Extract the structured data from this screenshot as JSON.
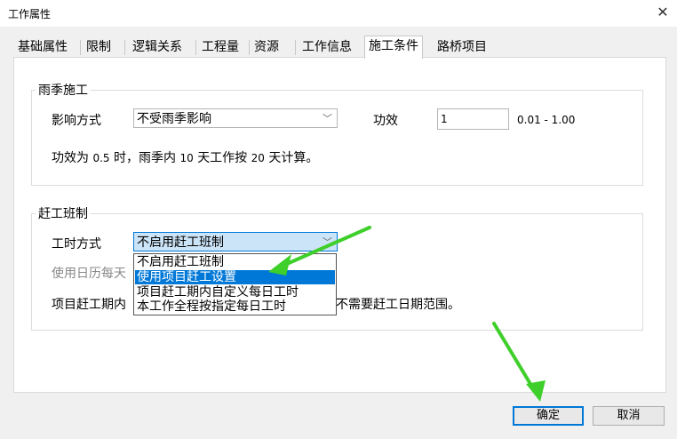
{
  "window": {
    "title": "工作属性",
    "close_icon": "close-icon"
  },
  "tabs": [
    {
      "label": "基础属性",
      "active": false
    },
    {
      "label": "限制",
      "active": false
    },
    {
      "label": "逻辑关系",
      "active": false
    },
    {
      "label": "工程量",
      "active": false
    },
    {
      "label": "资源",
      "active": false
    },
    {
      "label": "工作信息",
      "active": false
    },
    {
      "label": "施工条件",
      "active": true
    },
    {
      "label": "路桥项目",
      "active": false
    }
  ],
  "rain": {
    "group_label": "雨季施工",
    "impact_label": "影响方式",
    "impact_value": "不受雨季影响",
    "efficiency_label": "功效",
    "efficiency_value": "1",
    "efficiency_range": "0.01 - 1.00",
    "desc_1": "功效为",
    "desc_val1": "0.5",
    "desc_2": "时，雨季内",
    "desc_val2": "10",
    "desc_3": "天工作按",
    "desc_val3": "20",
    "desc_4": "天计算。"
  },
  "rush": {
    "group_label": "赶工班制",
    "mode_label": "工时方式",
    "mode_value": "不启用赶工班制",
    "calendar_hint": "使用日历每天",
    "period_text_left": "项目赶工期内",
    "period_text_right": "不需要赶工日期范围。",
    "options": [
      {
        "label": "不启用赶工班制",
        "selected": false
      },
      {
        "label": "使用项目赶工设置",
        "selected": true
      },
      {
        "label": "项目赶工期内自定义每日工时",
        "selected": false
      },
      {
        "label": "本工作全程按指定每日工时",
        "selected": false
      }
    ]
  },
  "buttons": {
    "ok": "确定",
    "cancel": "取消"
  },
  "colors": {
    "selection": "#0078d7",
    "annotation_arrow": "#3fcf2a"
  }
}
